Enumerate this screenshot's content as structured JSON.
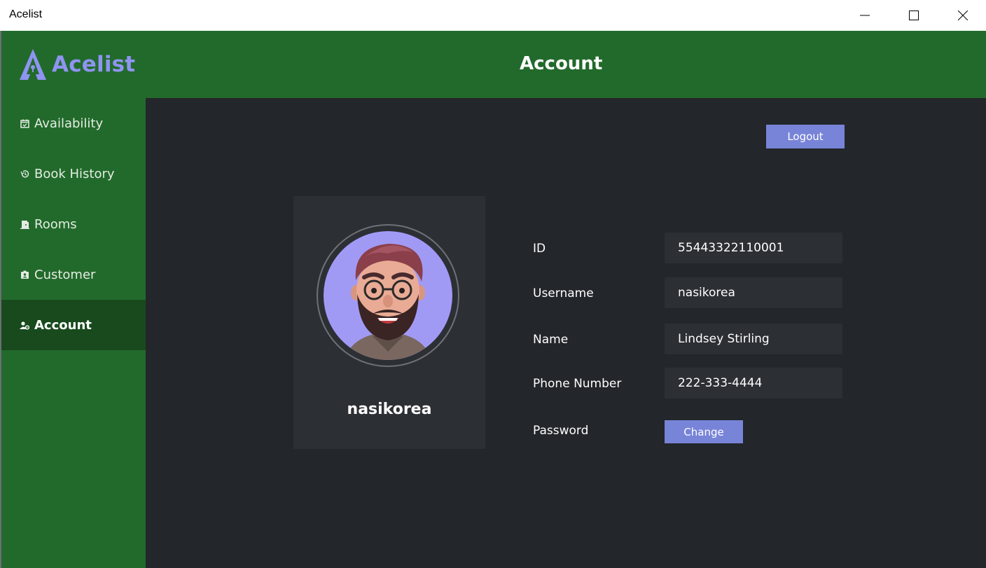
{
  "window": {
    "title": "Acelist",
    "minimize_label": "",
    "maximize_label": "",
    "close_label": ""
  },
  "header": {
    "logo_text": "Acelist",
    "page_title": "Account"
  },
  "sidebar": {
    "items": [
      {
        "label": "Availability",
        "icon": "calendar-check-icon",
        "active": false
      },
      {
        "label": "Book History",
        "icon": "history-icon",
        "active": false
      },
      {
        "label": "Rooms",
        "icon": "door-icon",
        "active": false
      },
      {
        "label": "Customer",
        "icon": "id-badge-icon",
        "active": false
      },
      {
        "label": "Account",
        "icon": "user-gear-icon",
        "active": true
      }
    ]
  },
  "main": {
    "logout_label": "Logout",
    "profile": {
      "username": "nasikorea"
    },
    "fields": [
      {
        "label": "ID",
        "value": "55443322110001"
      },
      {
        "label": "Username",
        "value": "nasikorea"
      },
      {
        "label": "Name",
        "value": "Lindsey Stirling"
      },
      {
        "label": "Phone Number",
        "value": "222-333-4444"
      }
    ],
    "password": {
      "label": "Password",
      "change_label": "Change"
    }
  },
  "colors": {
    "brand_green": "#226a2b",
    "active_green": "#184a1e",
    "accent": "#7884d8",
    "logo": "#8f94f2",
    "background": "#23262a",
    "panel": "#2c2f34"
  }
}
